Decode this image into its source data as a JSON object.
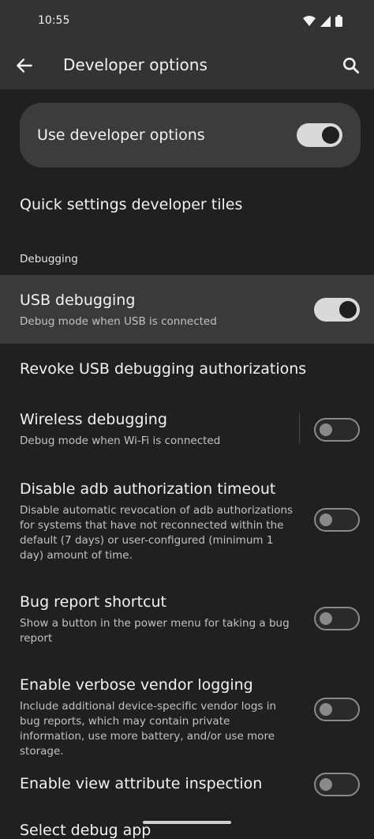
{
  "status_bar": {
    "time": "10:55",
    "icons": [
      "wifi-icon",
      "signal-icon",
      "battery-icon"
    ]
  },
  "app_bar": {
    "title": "Developer options",
    "back_icon": "arrow-back-icon",
    "search_icon": "search-icon"
  },
  "master_switch": {
    "label": "Use developer options",
    "on": true
  },
  "quick_settings": {
    "title": "Quick settings developer tiles"
  },
  "section": {
    "header": "Debugging"
  },
  "items": [
    {
      "title": "USB debugging",
      "subtitle": "Debug mode when USB is connected",
      "toggle": true,
      "on": true
    },
    {
      "title": "Revoke USB debugging authorizations",
      "subtitle": "",
      "toggle": false
    },
    {
      "title": "Wireless debugging",
      "subtitle": "Debug mode when Wi-Fi is connected",
      "toggle": true,
      "on": false
    },
    {
      "title": "Disable adb authorization timeout",
      "subtitle": "Disable automatic revocation of adb authorizations for systems that have not reconnected within the default (7 days) or user-configured (minimum 1 day) amount of time.",
      "toggle": true,
      "on": false
    },
    {
      "title": "Bug report shortcut",
      "subtitle": "Show a button in the power menu for taking a bug report",
      "toggle": true,
      "on": false
    },
    {
      "title": "Enable verbose vendor logging",
      "subtitle": "Include additional device-specific vendor logs in bug reports, which may contain private information, use more battery, and/or use more storage.",
      "toggle": true,
      "on": false
    },
    {
      "title": "Enable view attribute inspection",
      "subtitle": "",
      "toggle": true,
      "on": false
    }
  ],
  "partial_next_item": "Select debug app"
}
